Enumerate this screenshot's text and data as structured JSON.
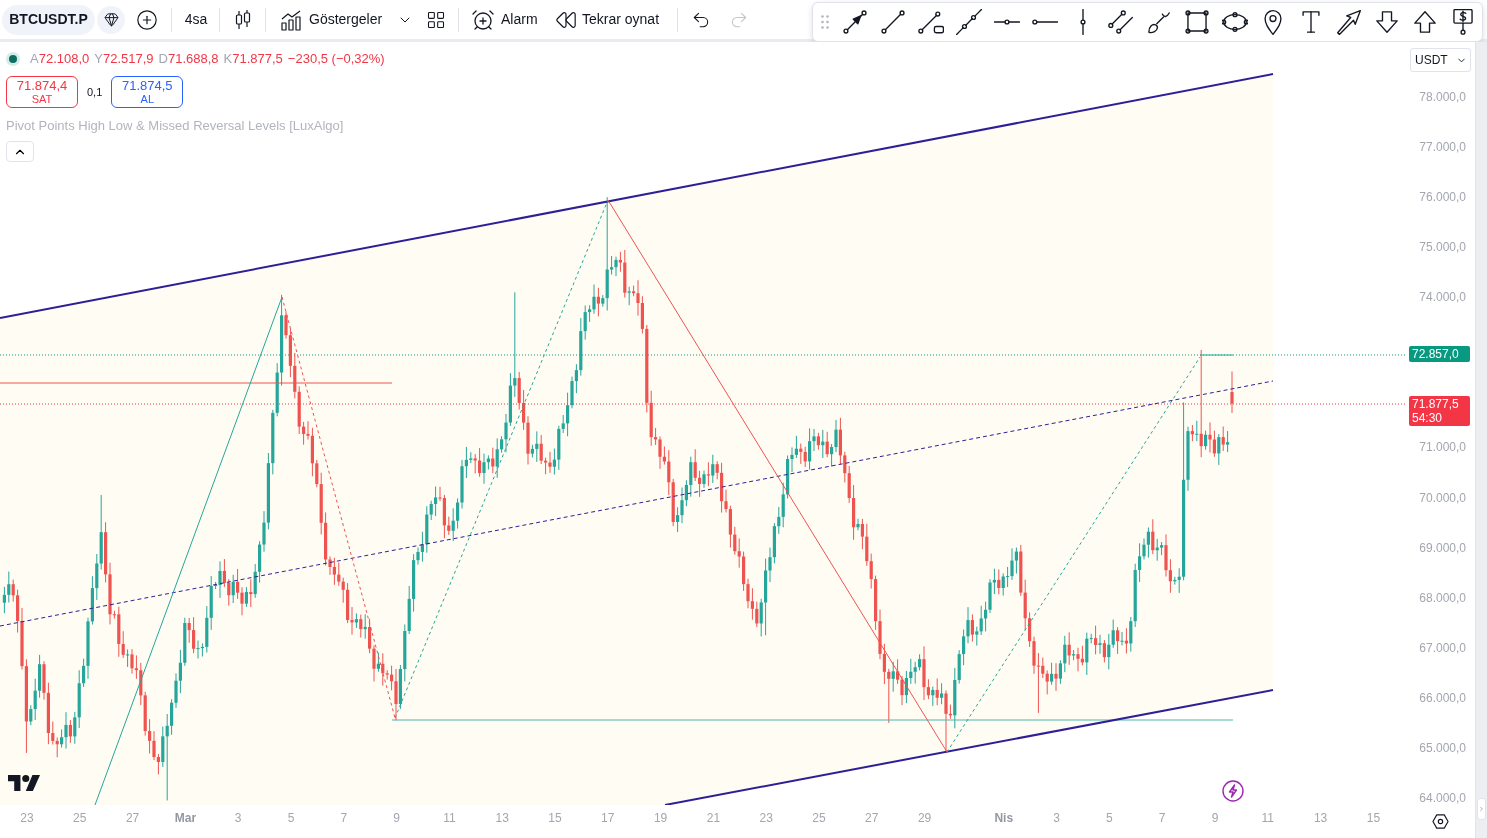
{
  "top_toolbar": {
    "symbol": "BTCUSDT.P",
    "interval": "4sa",
    "indicators_label": "Göstergeler",
    "alert_label": "Alarm",
    "replay_label": "Tekrar oynat",
    "undo": {
      "disabled": false
    },
    "redo": {
      "disabled": true
    }
  },
  "legend": {
    "ohlc": [
      {
        "label": "A",
        "value": "72.108,0"
      },
      {
        "label": "Y",
        "value": "72.517,9"
      },
      {
        "label": "D",
        "value": "71.688,8"
      },
      {
        "label": "K",
        "value": "71.877,5"
      }
    ],
    "change": "−230,5 (−0,32%)",
    "sell": {
      "price": "71.874,4",
      "label": "SAT"
    },
    "spread": "0,1",
    "buy": {
      "price": "71.874,5",
      "label": "AL"
    },
    "indicator": "Pivot Points High Low & Missed Reversal Levels [LuxAlgo]",
    "expanded": true
  },
  "price_axis": {
    "currency": "USDT",
    "ticks": [
      "78.000,0",
      "77.000,0",
      "76.000,0",
      "75.000,0",
      "74.000,0",
      "71.000,0",
      "70.000,0",
      "69.000,0",
      "68.000,0",
      "67.000,0",
      "66.000,0",
      "65.000,0",
      "64.000,0"
    ],
    "badges": [
      {
        "kind": "level",
        "price": "72.857,0"
      },
      {
        "kind": "last",
        "price": "71.877,5",
        "countdown": "54:30"
      }
    ]
  },
  "time_axis": {
    "labels": [
      {
        "text": "23",
        "kind": "day"
      },
      {
        "text": "25",
        "kind": "day"
      },
      {
        "text": "27",
        "kind": "day"
      },
      {
        "text": "Mar",
        "kind": "month"
      },
      {
        "text": "3",
        "kind": "day"
      },
      {
        "text": "5",
        "kind": "day"
      },
      {
        "text": "7",
        "kind": "day"
      },
      {
        "text": "9",
        "kind": "day"
      },
      {
        "text": "11",
        "kind": "day"
      },
      {
        "text": "13",
        "kind": "day"
      },
      {
        "text": "15",
        "kind": "day"
      },
      {
        "text": "17",
        "kind": "day"
      },
      {
        "text": "19",
        "kind": "day"
      },
      {
        "text": "21",
        "kind": "day"
      },
      {
        "text": "23",
        "kind": "day"
      },
      {
        "text": "25",
        "kind": "day"
      },
      {
        "text": "27",
        "kind": "day"
      },
      {
        "text": "29",
        "kind": "day"
      },
      {
        "text": "Nis",
        "kind": "month"
      },
      {
        "text": "3",
        "kind": "day"
      },
      {
        "text": "5",
        "kind": "day"
      },
      {
        "text": "7",
        "kind": "day"
      },
      {
        "text": "9",
        "kind": "day"
      },
      {
        "text": "11",
        "kind": "day"
      },
      {
        "text": "13",
        "kind": "day"
      },
      {
        "text": "15",
        "kind": "day"
      }
    ]
  }
}
